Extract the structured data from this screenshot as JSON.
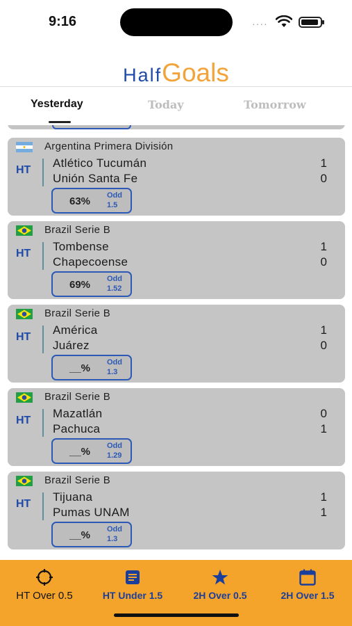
{
  "status_bar": {
    "time": "9:16",
    "dots": "····"
  },
  "header": {
    "logo_half": "Half",
    "logo_goals": "Goals"
  },
  "tabs": [
    {
      "label": "Yesterday",
      "active": true
    },
    {
      "label": "Today",
      "active": false
    },
    {
      "label": "Tomorrow",
      "active": false
    }
  ],
  "matches": [
    {
      "country": "argentina",
      "league": "Argentina Primera División",
      "period": "HT",
      "home": "Atlético Tucumán",
      "away": "Unión Santa Fe",
      "home_score": "1",
      "away_score": "0",
      "percent": "63%",
      "odd_label": "Odd",
      "odd": "1.5"
    },
    {
      "country": "brazil",
      "league": "Brazil Serie B",
      "period": "HT",
      "home": "Tombense",
      "away": "Chapecoense",
      "home_score": "1",
      "away_score": "0",
      "percent": "69%",
      "odd_label": "Odd",
      "odd": "1.52"
    },
    {
      "country": "brazil",
      "league": "Brazil Serie B",
      "period": "HT",
      "home": "América",
      "away": "Juárez",
      "home_score": "1",
      "away_score": "0",
      "percent": "__%",
      "odd_label": "Odd",
      "odd": "1.3"
    },
    {
      "country": "brazil",
      "league": "Brazil Serie B",
      "period": "HT",
      "home": "Mazatlán",
      "away": "Pachuca",
      "home_score": "0",
      "away_score": "1",
      "percent": "__%",
      "odd_label": "Odd",
      "odd": "1.29"
    },
    {
      "country": "brazil",
      "league": "Brazil Serie B",
      "period": "HT",
      "home": "Tijuana",
      "away": "Pumas UNAM",
      "home_score": "1",
      "away_score": "1",
      "percent": "__%",
      "odd_label": "Odd",
      "odd": "1.3"
    }
  ],
  "bottom_nav": [
    {
      "label": "HT Over 0.5",
      "icon": "target-icon"
    },
    {
      "label": "HT Under 1.5",
      "icon": "document-icon"
    },
    {
      "label": "2H Over 0.5",
      "icon": "star-icon"
    },
    {
      "label": "2H Over 1.5",
      "icon": "calendar-icon"
    }
  ],
  "colors": {
    "accent": "#f5a42b",
    "brand_blue": "#1f4aa8",
    "card": "#c5c5c5"
  }
}
